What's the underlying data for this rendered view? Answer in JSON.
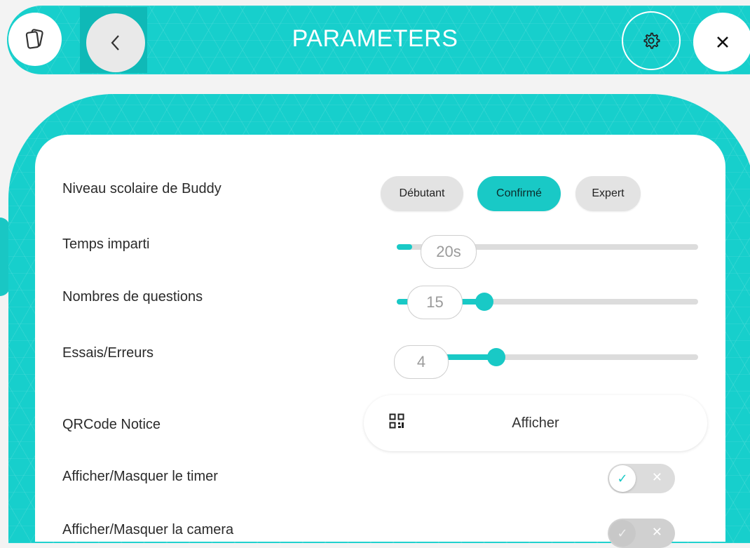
{
  "header": {
    "title": "PARAMETERS",
    "icons": [
      "cards-icon",
      "chevron-left-icon",
      "gear-icon",
      "close-icon"
    ]
  },
  "settings": {
    "level": {
      "label": "Niveau scolaire de Buddy",
      "options": [
        "Débutant",
        "Confirmé",
        "Expert"
      ],
      "selected": "Confirmé"
    },
    "time": {
      "label": "Temps imparti",
      "value": "20s",
      "fraction": 0.05
    },
    "questions": {
      "label": "Nombres de questions",
      "value": "15",
      "fraction": 0.29
    },
    "attempts": {
      "label": "Essais/Erreurs",
      "value": "4",
      "fraction": 0.33
    },
    "qrcode": {
      "label": "QRCode Notice",
      "button": "Afficher"
    },
    "timer": {
      "label": "Afficher/Masquer le timer",
      "on": true
    },
    "camera": {
      "label": "Afficher/Masquer la camera",
      "on": false
    }
  },
  "colors": {
    "accent": "#19c9c6",
    "track": "#dcdcdc"
  }
}
